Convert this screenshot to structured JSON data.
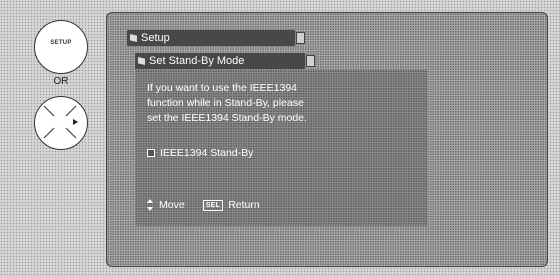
{
  "remote": {
    "setup_label": "SETUP",
    "or_label": "OR"
  },
  "screen": {
    "tab_setup": "Setup",
    "tab_standby": "Set Stand-By Mode",
    "description": [
      "If you want to use the IEEE1394",
      "function while in Stand-By, please",
      "set the IEEE1394 Stand-By mode."
    ],
    "option_label": "IEEE1394 Stand-By",
    "footer": {
      "move_label": "Move",
      "sel_key": "SEL",
      "return_label": "Return"
    }
  }
}
